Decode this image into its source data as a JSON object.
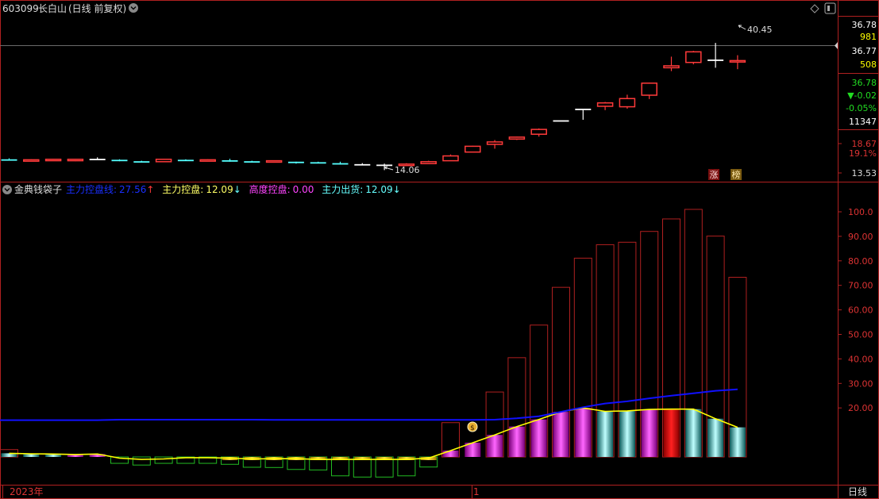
{
  "header": {
    "code": "603099",
    "name": "长白山",
    "mode": "(日线 前复权)"
  },
  "indicator": {
    "name": "金典钱袋子",
    "items": [
      {
        "label": "主力控盘线:",
        "value": "27.56",
        "arrow": "↑",
        "color": "#1a2fff"
      },
      {
        "label": "主力控盘:",
        "value": "12.09",
        "arrow": "↓",
        "color": "#ffff66"
      },
      {
        "label": "高度控盘:",
        "value": "0.00",
        "arrow": "",
        "color": "#ff44ff"
      },
      {
        "label": "主力出货:",
        "value": "12.09",
        "arrow": "↓",
        "color": "#66ffff"
      }
    ]
  },
  "right_panel": {
    "price1": "36.78",
    "vol1": "981",
    "price2": "36.77",
    "vol2": "508",
    "last": "36.78",
    "change": "▼-0.02",
    "pct": "-0.05%",
    "volume": "11347",
    "mid_price": "18.67",
    "mid_pct": "19.1%",
    "low_price": "13.53"
  },
  "annotations": {
    "high": "40.45",
    "low": "14.06",
    "badge1": "涨",
    "badge2": "榜"
  },
  "footer": {
    "year": "2023年",
    "month": "1",
    "period": "日线"
  },
  "colors": {
    "up": "#ff3a3a",
    "down": "#54ffff",
    "neutral": "#ffffff",
    "ma": "#1010ff",
    "yellow": "#ffff00",
    "green": "#22bb22",
    "magenta": "#ff00ff",
    "frame": "#b02020"
  },
  "chart_data": [
    {
      "type": "candlestick",
      "title": "603099 长白山 (日线 前复权)",
      "ylim": [
        13.53,
        40.45
      ],
      "candles": [
        {
          "o": 16.3,
          "h": 16.5,
          "l": 16.1,
          "c": 16.2
        },
        {
          "o": 16.1,
          "h": 16.3,
          "l": 16.0,
          "c": 16.2
        },
        {
          "o": 16.1,
          "h": 16.4,
          "l": 16.0,
          "c": 16.3
        },
        {
          "o": 16.0,
          "h": 16.4,
          "l": 15.9,
          "c": 16.3
        },
        {
          "o": 16.4,
          "h": 16.7,
          "l": 16.2,
          "c": 16.4
        },
        {
          "o": 16.2,
          "h": 16.3,
          "l": 15.9,
          "c": 16.0
        },
        {
          "o": 15.9,
          "h": 16.0,
          "l": 15.7,
          "c": 15.8
        },
        {
          "o": 15.8,
          "h": 16.4,
          "l": 15.7,
          "c": 16.3
        },
        {
          "o": 16.2,
          "h": 16.3,
          "l": 16.1,
          "c": 16.1
        },
        {
          "o": 16.0,
          "h": 16.3,
          "l": 15.9,
          "c": 16.2
        },
        {
          "o": 16.1,
          "h": 16.4,
          "l": 15.8,
          "c": 16.0
        },
        {
          "o": 15.9,
          "h": 16.0,
          "l": 15.7,
          "c": 15.7
        },
        {
          "o": 15.7,
          "h": 16.1,
          "l": 15.6,
          "c": 16.0
        },
        {
          "o": 15.8,
          "h": 15.8,
          "l": 15.4,
          "c": 15.5
        },
        {
          "o": 15.7,
          "h": 15.8,
          "l": 15.5,
          "c": 15.5
        },
        {
          "o": 15.5,
          "h": 15.8,
          "l": 15.2,
          "c": 15.3
        },
        {
          "o": 15.3,
          "h": 15.5,
          "l": 15.2,
          "c": 15.3
        },
        {
          "o": 15.2,
          "h": 15.4,
          "l": 14.06,
          "c": 15.2
        },
        {
          "o": 15.2,
          "h": 15.5,
          "l": 15.1,
          "c": 15.3
        },
        {
          "o": 15.4,
          "h": 16.0,
          "l": 15.3,
          "c": 15.8
        },
        {
          "o": 16.0,
          "h": 17.3,
          "l": 16.0,
          "c": 17.0
        },
        {
          "o": 17.8,
          "h": 19.1,
          "l": 17.8,
          "c": 19.0
        },
        {
          "o": 19.4,
          "h": 20.3,
          "l": 18.5,
          "c": 19.9
        },
        {
          "o": 20.5,
          "h": 21.0,
          "l": 20.3,
          "c": 20.9
        },
        {
          "o": 21.5,
          "h": 22.7,
          "l": 21.0,
          "c": 22.5
        },
        {
          "o": 24.4,
          "h": 24.4,
          "l": 24.4,
          "c": 24.4
        },
        {
          "o": 26.8,
          "h": 26.8,
          "l": 24.5,
          "c": 26.8
        },
        {
          "o": 27.3,
          "h": 28.2,
          "l": 26.5,
          "c": 28.0
        },
        {
          "o": 27.2,
          "h": 29.7,
          "l": 26.8,
          "c": 28.9
        },
        {
          "o": 29.6,
          "h": 32.2,
          "l": 28.8,
          "c": 32.1
        },
        {
          "o": 35.3,
          "h": 37.6,
          "l": 34.6,
          "c": 35.7
        },
        {
          "o": 36.4,
          "h": 38.8,
          "l": 36.0,
          "c": 38.6
        },
        {
          "o": 37.0,
          "h": 40.45,
          "l": 35.3,
          "c": 37.0
        },
        {
          "o": 36.5,
          "h": 37.9,
          "l": 35.0,
          "c": 36.78
        }
      ]
    },
    {
      "type": "bar",
      "title": "金典钱袋子",
      "ylim": [
        0,
        100
      ],
      "y_ticks": [
        "20.00",
        "30.00",
        "40.00",
        "50.00",
        "60.00",
        "70.00",
        "80.00",
        "90.00",
        "100.0"
      ],
      "series": [
        {
          "name": "主力控盘线",
          "values": [
            15,
            15,
            15,
            15,
            15,
            15.2,
            15.2,
            15.2,
            15.2,
            15.2,
            15.2,
            15.2,
            15.1,
            15.1,
            15.1,
            15.1,
            15.1,
            15.1,
            15.1,
            15.1,
            15.1,
            15.1,
            15.2,
            15.8,
            16.6,
            18.4,
            20.3,
            21.8,
            22.7,
            23.9,
            25.0,
            26.0,
            27.0,
            27.56
          ]
        },
        {
          "name": "主力控盘",
          "values": [
            1.5,
            1.3,
            1.2,
            1.0,
            1.2,
            -0.5,
            -1.0,
            -0.8,
            -0.3,
            -0.3,
            -0.5,
            -0.8,
            -0.7,
            -0.7,
            -1.0,
            -1.0,
            -1.0,
            -1.0,
            -1.0,
            -0.5,
            2.6,
            5.8,
            9.0,
            12.4,
            15.3,
            18.4,
            20.0,
            18.6,
            18.8,
            19.4,
            19.5,
            19.5,
            15.6,
            12.09
          ]
        },
        {
          "name": "高度控盘",
          "values": [
            0,
            0,
            0,
            0,
            0,
            0,
            0,
            0,
            0,
            0,
            0,
            0,
            0,
            0,
            0,
            0,
            0,
            0,
            0,
            0,
            0,
            0,
            0,
            0,
            0,
            0,
            0,
            0,
            0,
            0,
            0,
            0,
            0,
            0.0
          ]
        },
        {
          "name": "主力出货",
          "values": [
            0,
            0,
            0,
            0,
            0,
            0,
            0,
            0,
            0,
            0,
            0,
            0,
            0,
            0,
            0,
            0,
            0,
            0,
            0,
            0,
            0,
            0,
            0,
            0,
            0,
            0,
            0,
            19.0,
            18.8,
            0,
            0,
            19.5,
            15.6,
            12.09
          ]
        },
        {
          "name": "frame",
          "values": [
            3.0,
            0,
            0,
            0,
            0,
            0,
            0,
            0,
            0,
            0,
            0,
            0,
            0,
            0,
            0,
            0,
            0,
            0,
            0,
            0,
            14.0,
            0,
            26.5,
            40.5,
            53.8,
            69.2,
            81.1,
            86.6,
            87.6,
            92.0,
            97.1,
            101.0,
            90.1,
            73.3
          ]
        },
        {
          "name": "green_box",
          "values": [
            0,
            0,
            0,
            0,
            0,
            -2.6,
            -3.3,
            -2.6,
            -2.6,
            -2.6,
            -3.0,
            -4.2,
            -4.3,
            -5.1,
            -5.3,
            -7.7,
            -8.2,
            -8.2,
            -7.7,
            -4.1,
            0,
            0,
            0,
            0,
            0,
            0,
            0,
            0,
            0,
            0,
            0,
            0,
            0,
            0
          ]
        }
      ]
    }
  ]
}
